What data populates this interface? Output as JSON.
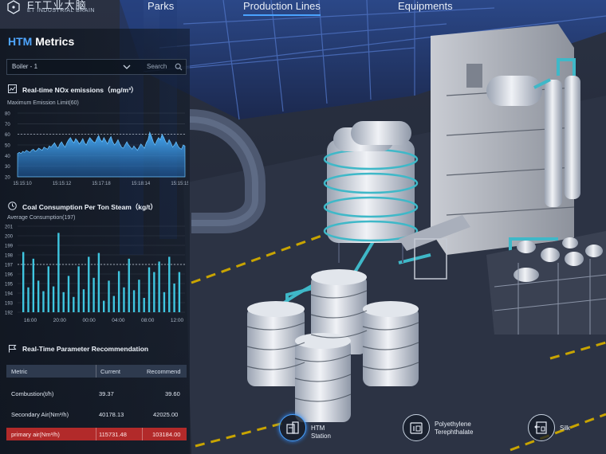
{
  "app": {
    "logo_title": "ET工业大脑",
    "logo_subtitle": "ET INDUSTRIAL BRAIN"
  },
  "nav": {
    "items": [
      {
        "label": "Parks",
        "active": false
      },
      {
        "label": "Production Lines",
        "active": true
      },
      {
        "label": "Equipments",
        "active": false
      }
    ]
  },
  "panel": {
    "title_accent": "HTM",
    "title_rest": " Metrics",
    "selector": {
      "value": "Boiler - 1",
      "search_label": "Search"
    }
  },
  "nox": {
    "title": "Real-time NOx emissions（mg/m³）",
    "limit_label": "Maximum Emission Limit(60)",
    "chart_data": {
      "type": "area",
      "title": "Real-time NOx emissions（mg/m³）",
      "x_ticks": [
        "15:15:10",
        "15:15:12",
        "15:17:18",
        "15:18:14",
        "15:15:15"
      ],
      "y_ticks": [
        80,
        70,
        60,
        50,
        40,
        30,
        20
      ],
      "ylim": [
        20,
        80
      ],
      "limit_value": 60,
      "grid": true,
      "values": [
        42,
        43,
        42,
        44,
        43,
        45,
        44,
        43,
        45,
        46,
        44,
        45,
        47,
        46,
        45,
        48,
        47,
        46,
        49,
        48,
        50,
        52,
        49,
        47,
        51,
        53,
        50,
        48,
        52,
        55,
        57,
        54,
        52,
        56,
        54,
        51,
        53,
        56,
        52,
        50,
        54,
        57,
        55,
        53,
        52,
        56,
        59,
        55,
        53,
        57,
        54,
        51,
        55,
        58,
        53,
        50,
        52,
        55,
        51,
        48,
        47,
        50,
        53,
        50,
        48,
        46,
        49,
        47,
        45,
        48,
        51,
        49,
        47,
        52,
        55,
        62,
        58,
        53,
        50,
        54,
        57,
        55,
        60,
        57,
        53,
        51,
        55,
        52,
        48,
        50,
        53,
        49,
        47,
        46,
        50,
        49
      ]
    }
  },
  "coal": {
    "title": "Coal Consumption Per Ton Steam（kg/t）",
    "avg_label": "Average Consumption(197)",
    "chart_data": {
      "type": "bar",
      "title": "Coal Consumption Per Ton Steam（kg/t）",
      "x_ticks": [
        "16:00",
        "20:00",
        "00:00",
        "04:00",
        "08:00",
        "12:00"
      ],
      "y_ticks": [
        201,
        200,
        199,
        198,
        197,
        196,
        195,
        194,
        193,
        192
      ],
      "ylim": [
        192,
        201
      ],
      "average_value": 197,
      "grid": true,
      "values": [
        198.3,
        194.6,
        197.6,
        195.3,
        194.2,
        196.8,
        194.7,
        200.3,
        194.1,
        195.8,
        193.6,
        196.8,
        194.4,
        197.8,
        195.6,
        198.2,
        193.2,
        195.3,
        193.7,
        196.3,
        194.6,
        197.6,
        194.3,
        195.4,
        193.5,
        196.7,
        196.2,
        197.3,
        194.1,
        197.8,
        195.0,
        196.2
      ]
    }
  },
  "recommend": {
    "title": "Real-Time Parameter Recommendation",
    "headers": [
      "Metric",
      "Current",
      "Recommend"
    ],
    "rows": [
      {
        "metric": "Combustion(t/h)",
        "current": "39.37",
        "recommend": "39.60",
        "alert": false
      },
      {
        "metric": "Secondary Air(Nm³/h)",
        "current": "40178.13",
        "recommend": "42025.00",
        "alert": false
      },
      {
        "metric": "primary air(Nm³/h)",
        "current": "115731.48",
        "recommend": "103184.00",
        "alert": true
      }
    ]
  },
  "stations": [
    {
      "label_line1": "HTM Station",
      "label_line2": "",
      "icon": "htm-station-icon",
      "active": true
    },
    {
      "label_line1": "Polyethylene",
      "label_line2": "Terephthalate",
      "icon": "pet-icon",
      "active": false
    },
    {
      "label_line1": "Silk",
      "label_line2": "",
      "icon": "silk-icon",
      "active": false
    }
  ],
  "colors": {
    "accent": "#4aa3ff",
    "alert": "#b22a2a",
    "chart_fill": "#3aa0e8",
    "pipe": "#3fb8c8"
  }
}
